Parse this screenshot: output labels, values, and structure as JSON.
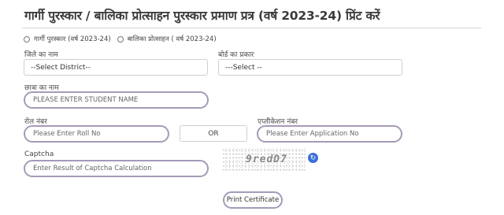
{
  "page": {
    "title": "गार्गी पुरस्कार / बालिका प्रोत्साहन पुरस्कार प्रमाण प्रत्र (वर्ष 2023-24) प्रिंट करें"
  },
  "award_type": {
    "options": [
      "गार्गी पुरस्कार (वर्ष 2023-24)",
      "बालिका प्रोत्साहन ( वर्ष 2023-24)"
    ]
  },
  "district": {
    "label": "जिले का नाम",
    "selected": "--Select District--"
  },
  "board": {
    "label": "बोर्ड का प्रकार",
    "selected": "---Select --"
  },
  "student": {
    "label": "छात्रा का नाम",
    "placeholder": "PLEASE ENTER STUDENT NAME"
  },
  "roll": {
    "label": "रोल नंबर",
    "placeholder": "Please Enter Roll No"
  },
  "or_text": "OR",
  "application": {
    "label": "एप्लीकेशन नंबर",
    "placeholder": "Please Enter Application No"
  },
  "captcha": {
    "label": "Captcha",
    "placeholder": "Enter Result of Captcha Calculation",
    "image_text": "9redD7",
    "refresh_icon": "refresh-icon"
  },
  "actions": {
    "print_label": "Print Certificate"
  },
  "colors": {
    "input_border": "#a59ab8",
    "refresh_bg": "#3b6fd8"
  }
}
